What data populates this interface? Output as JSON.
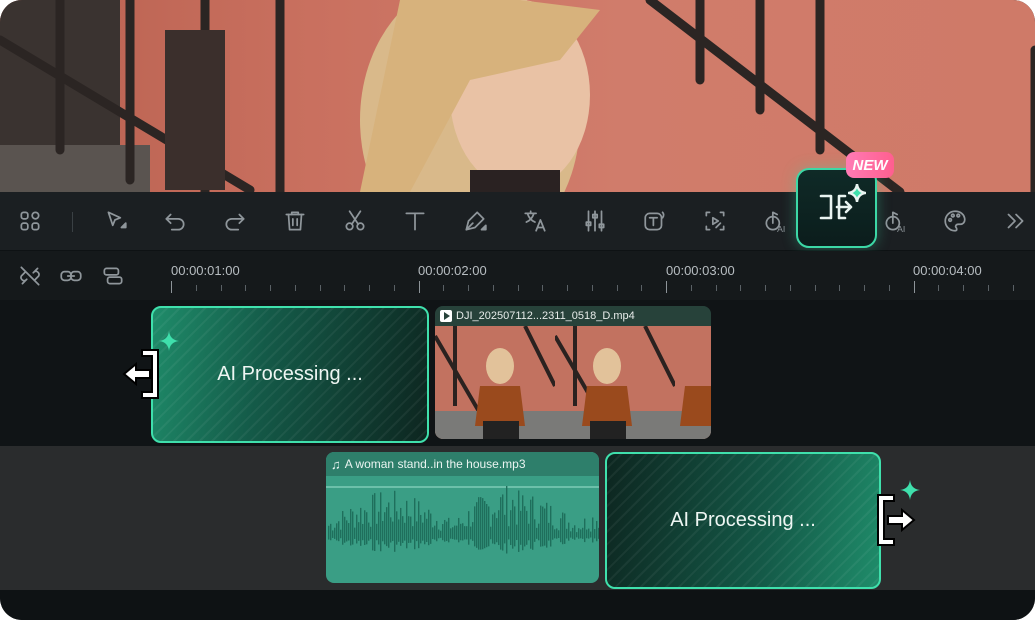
{
  "badge": {
    "new": "NEW"
  },
  "ruler": {
    "times": [
      "00:00:01:00",
      "00:00:02:00",
      "00:00:03:00",
      "00:00:04:00"
    ]
  },
  "track1": {
    "ai_clip_label": "AI Processing ...",
    "video_clip_name": "DJI_202507112...2311_0518_D.mp4"
  },
  "track2": {
    "audio_clip_name": "A woman stand..in the house.mp3",
    "ai_clip_label": "AI Processing ..."
  },
  "toolbar": {
    "icons": [
      "apps-icon",
      "select-tool-icon",
      "undo-icon",
      "redo-icon",
      "delete-icon",
      "cut-icon",
      "text-icon",
      "pen-icon",
      "translate-icon",
      "adjust-icon",
      "ai-text-icon",
      "ai-clip-icon",
      "ai-audio-icon",
      "ai-split-extend-icon",
      "ai-music-icon",
      "palette-icon",
      "more-icon"
    ]
  },
  "colors": {
    "accent": "#3fe0ac",
    "badge": "#ff6a9a",
    "background": "#0e1214"
  }
}
